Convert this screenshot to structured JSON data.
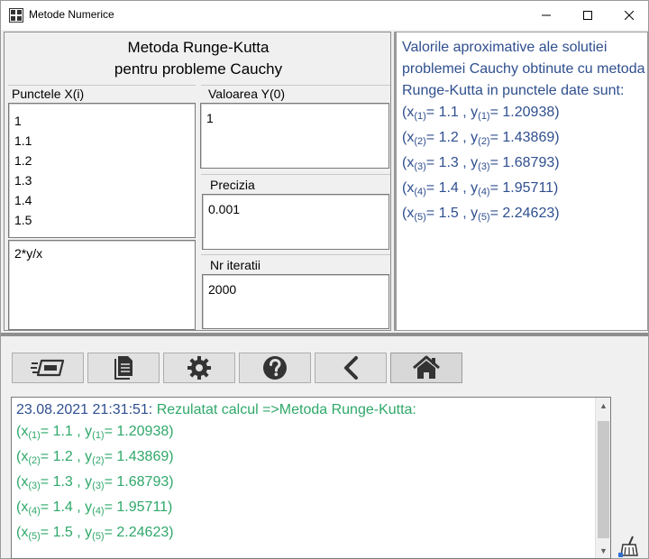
{
  "window": {
    "title": "Metode Numerice"
  },
  "heading": {
    "line1": "Metoda Runge-Kutta",
    "line2": "pentru probleme Cauchy"
  },
  "points": {
    "label": "Punctele X(i)",
    "values": [
      "1",
      "1.1",
      "1.2",
      "1.3",
      "1.4",
      "1.5"
    ]
  },
  "function": {
    "value": "2*y/x"
  },
  "y0": {
    "label": "Valoarea Y(0)",
    "value": "1"
  },
  "precision": {
    "label": "Precizia",
    "value": "0.001"
  },
  "iterations": {
    "label": "Nr iteratii",
    "value": "2000"
  },
  "result": {
    "intro": "Valorile aproximative ale solutiei problemei Cauchy obtinute cu metoda Runge-Kutta in punctele date sunt:",
    "rows": [
      {
        "x_open": "(x",
        "i": "(1)",
        "x_val": "= 1.1 , y",
        "j": "(1)",
        "y_val": "= 1.20938)"
      },
      {
        "x_open": "(x",
        "i": "(2)",
        "x_val": "= 1.2 , y",
        "j": "(2)",
        "y_val": "= 1.43869)"
      },
      {
        "x_open": "(x",
        "i": "(3)",
        "x_val": "= 1.3 , y",
        "j": "(3)",
        "y_val": "= 1.68793)"
      },
      {
        "x_open": "(x",
        "i": "(4)",
        "x_val": "= 1.4 , y",
        "j": "(4)",
        "y_val": "= 1.95711)"
      },
      {
        "x_open": "(x",
        "i": "(5)",
        "x_val": "= 1.5 , y",
        "j": "(5)",
        "y_val": "= 2.24623)"
      }
    ]
  },
  "toolbar": {
    "buttons": [
      "run-icon",
      "document-icon",
      "gear-icon",
      "help-icon",
      "back-icon",
      "home-icon"
    ]
  },
  "log": {
    "timestamp": "23.08.2021 21:31:51:",
    "message": " Rezulatat calcul =>Metoda Runge-Kutta:"
  },
  "colors": {
    "result_text": "#2f4f8f",
    "log_text": "#2fa86a"
  }
}
